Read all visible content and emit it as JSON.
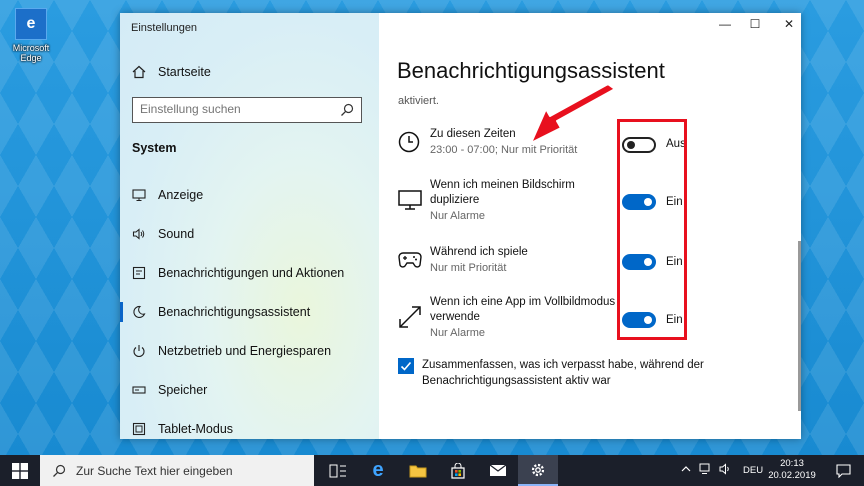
{
  "desktop": {
    "icon_label": "Microsoft Edge",
    "icon_letter": "e"
  },
  "window": {
    "title": "Einstellungen",
    "controls": {
      "minimize": "—",
      "maximize": "☐",
      "close": "✕"
    }
  },
  "sidebar": {
    "home_label": "Startseite",
    "search_placeholder": "Einstellung suchen",
    "section_label": "System",
    "items": [
      {
        "label": "Anzeige",
        "icon": "monitor-icon"
      },
      {
        "label": "Sound",
        "icon": "speaker-icon"
      },
      {
        "label": "Benachrichtigungen und Aktionen",
        "icon": "notification-icon"
      },
      {
        "label": "Benachrichtigungsassistent",
        "icon": "moon-icon",
        "active": true
      },
      {
        "label": "Netzbetrieb und Energiesparen",
        "icon": "power-icon"
      },
      {
        "label": "Speicher",
        "icon": "storage-icon"
      },
      {
        "label": "Tablet-Modus",
        "icon": "tablet-icon"
      }
    ]
  },
  "main": {
    "title": "Benachrichtigungsassistent",
    "cut_text": "aktiviert.",
    "rules": [
      {
        "title": "Zu diesen Zeiten",
        "subtitle": "23:00 - 07:00; Nur mit Priorität",
        "state": "Aus",
        "on": false,
        "icon": "clock-icon"
      },
      {
        "title": "Wenn ich meinen Bildschirm dupliziere",
        "subtitle": "Nur Alarme",
        "state": "Ein",
        "on": true,
        "icon": "monitor-icon"
      },
      {
        "title": "Während ich spiele",
        "subtitle": "Nur mit Priorität",
        "state": "Ein",
        "on": true,
        "icon": "gamepad-icon"
      },
      {
        "title": "Wenn ich eine App im Vollbildmodus verwende",
        "subtitle": "Nur Alarme",
        "state": "Ein",
        "on": true,
        "icon": "fullscreen-icon"
      }
    ],
    "summary_checkbox": {
      "label": "Zusammenfassen, was ich verpasst habe, während der Benachrichtigungsassistent aktiv war",
      "checked": true
    }
  },
  "taskbar": {
    "search_placeholder": "Zur Suche Text hier eingeben",
    "language": "DEU",
    "time": "20:13",
    "date": "20.02.2019"
  },
  "colors": {
    "accent": "#0067c8",
    "highlight": "#e8101e",
    "taskbar": "#1b1f2a"
  }
}
